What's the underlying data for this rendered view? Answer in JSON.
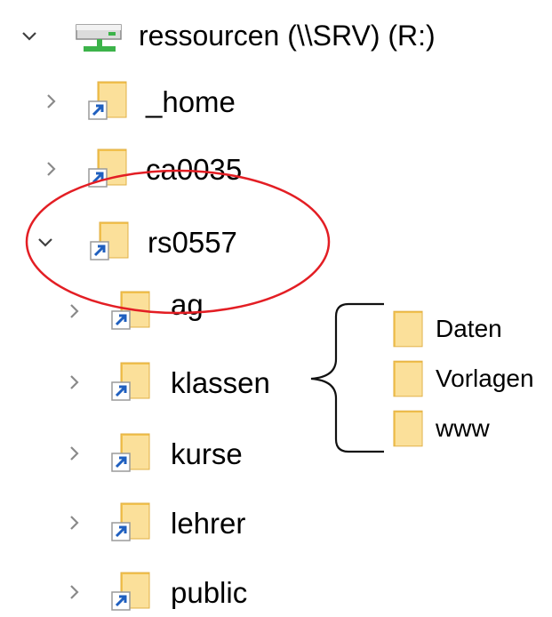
{
  "tree": {
    "drive": {
      "label": "ressourcen (\\\\SRV) (R:)",
      "expanded": true,
      "icon": "network-drive-icon"
    },
    "items": [
      {
        "label": "_home",
        "expanded": false,
        "icon": "folder-shortcut-icon"
      },
      {
        "label": "ca0035",
        "expanded": false,
        "icon": "folder-shortcut-icon"
      },
      {
        "label": "rs0557",
        "expanded": true,
        "icon": "folder-shortcut-icon"
      }
    ],
    "children": [
      {
        "label": "ag",
        "expanded": false,
        "icon": "folder-shortcut-icon"
      },
      {
        "label": "klassen",
        "expanded": false,
        "icon": "folder-shortcut-icon"
      },
      {
        "label": "kurse",
        "expanded": false,
        "icon": "folder-shortcut-icon"
      },
      {
        "label": "lehrer",
        "expanded": false,
        "icon": "folder-shortcut-icon"
      },
      {
        "label": "public",
        "expanded": false,
        "icon": "folder-shortcut-icon"
      }
    ]
  },
  "annotation": {
    "subfolders": [
      {
        "label": "Daten",
        "icon": "folder-icon"
      },
      {
        "label": "Vorlagen",
        "icon": "folder-icon"
      },
      {
        "label": "www",
        "icon": "folder-icon"
      }
    ],
    "highlight_color": "#e31e24"
  },
  "colors": {
    "folder_fill": "#fbe09a",
    "folder_back": "#f3c24e",
    "chevron": "#8a8a8a",
    "drive_green": "#3cb34a"
  }
}
